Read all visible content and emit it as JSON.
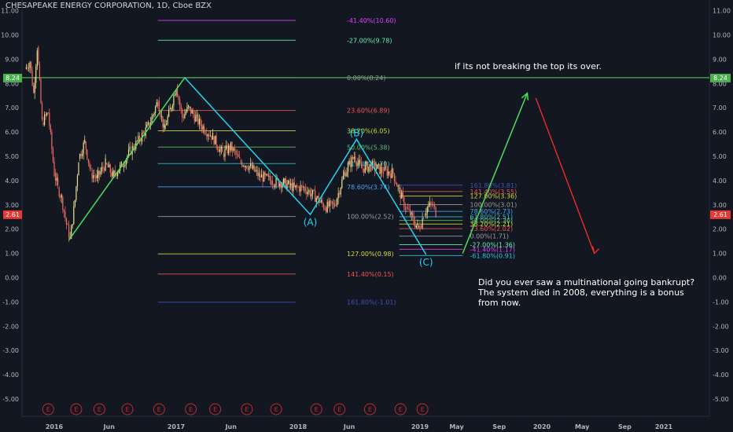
{
  "header": {
    "title": "CHESAPEAKE ENERGY CORPORATION, 1D, Cboe BZX"
  },
  "annotations": {
    "top_note": "if its not breaking the top its over.",
    "bottom_note": "Did you ever saw a multinational going bankrupt? The system died in 2008, everything is a bonus from now."
  },
  "colors": {
    "background": "#131722",
    "axis_text": "#b2b5be",
    "wave": "#22d3ee",
    "up_arrow": "#4ade5a",
    "down_arrow": "#ff2a2a",
    "candle_up": "#e9e08a",
    "candle_down": "#ef6b5f",
    "earnings": "#c62828"
  },
  "chart_data": {
    "type": "candlestick",
    "title": "CHESAPEAKE ENERGY CORPORATION, 1D, Cboe BZX",
    "y_axis": {
      "ylim": [
        -5.5,
        11.4
      ],
      "ticks": [
        11,
        10,
        9,
        8,
        7,
        6,
        5,
        4,
        3,
        2,
        1,
        0,
        -1,
        -2,
        -3,
        -4,
        -5
      ],
      "tick_labels": [
        "11.00",
        "10.00",
        "9.00",
        "8.00",
        "7.00",
        "6.00",
        "5.00",
        "4.00",
        "3.00",
        "2.00",
        "1.00",
        "0.00",
        "-1.00",
        "-2.00",
        "-3.00",
        "-4.00",
        "-5.00"
      ],
      "grid": false,
      "position": "both"
    },
    "x_axis": {
      "range": [
        2015.75,
        2021.25
      ],
      "ticks": [
        {
          "label": "2016",
          "x": 2016.0
        },
        {
          "label": "Jun",
          "x": 2016.45
        },
        {
          "label": "2017",
          "x": 2017.0
        },
        {
          "label": "Jun",
          "x": 2017.45
        },
        {
          "label": "2018",
          "x": 2018.0
        },
        {
          "label": "Jun",
          "x": 2018.42
        },
        {
          "label": "2019",
          "x": 2019.0
        },
        {
          "label": "May",
          "x": 2019.3
        },
        {
          "label": "Sep",
          "x": 2019.65
        },
        {
          "label": "2020",
          "x": 2020.0
        },
        {
          "label": "May",
          "x": 2020.33
        },
        {
          "label": "Sep",
          "x": 2020.68
        },
        {
          "label": "2021",
          "x": 2021.0
        }
      ]
    },
    "price_path": [
      [
        2015.76,
        8.6
      ],
      [
        2015.8,
        8.9
      ],
      [
        2015.83,
        7.6
      ],
      [
        2015.86,
        9.5
      ],
      [
        2015.9,
        6.4
      ],
      [
        2015.95,
        6.8
      ],
      [
        2016.0,
        4.3
      ],
      [
        2016.03,
        3.7
      ],
      [
        2016.06,
        3.3
      ],
      [
        2016.1,
        2.2
      ],
      [
        2016.13,
        1.6
      ],
      [
        2016.17,
        3.2
      ],
      [
        2016.2,
        4.9
      ],
      [
        2016.25,
        5.6
      ],
      [
        2016.3,
        4.3
      ],
      [
        2016.35,
        4.1
      ],
      [
        2016.42,
        4.7
      ],
      [
        2016.48,
        4.2
      ],
      [
        2016.55,
        4.6
      ],
      [
        2016.62,
        5.2
      ],
      [
        2016.7,
        5.7
      ],
      [
        2016.78,
        6.3
      ],
      [
        2016.85,
        7.3
      ],
      [
        2016.9,
        6.1
      ],
      [
        2016.95,
        6.9
      ],
      [
        2017.0,
        7.9
      ],
      [
        2017.05,
        6.6
      ],
      [
        2017.1,
        7.0
      ],
      [
        2017.2,
        6.3
      ],
      [
        2017.3,
        5.8
      ],
      [
        2017.38,
        5.1
      ],
      [
        2017.45,
        5.4
      ],
      [
        2017.52,
        4.8
      ],
      [
        2017.6,
        4.6
      ],
      [
        2017.68,
        4.2
      ],
      [
        2017.78,
        4.0
      ],
      [
        2017.88,
        3.9
      ],
      [
        2017.97,
        3.7
      ],
      [
        2018.05,
        3.7
      ],
      [
        2018.15,
        3.3
      ],
      [
        2018.22,
        2.9
      ],
      [
        2018.3,
        3.0
      ],
      [
        2018.38,
        4.3
      ],
      [
        2018.46,
        5.0
      ],
      [
        2018.52,
        4.5
      ],
      [
        2018.6,
        4.6
      ],
      [
        2018.7,
        4.4
      ],
      [
        2018.78,
        4.3
      ],
      [
        2018.82,
        3.7
      ],
      [
        2018.88,
        2.9
      ],
      [
        2018.92,
        2.6
      ],
      [
        2018.95,
        2.3
      ],
      [
        2018.98,
        2.1
      ],
      [
        2019.0,
        2.1
      ],
      [
        2019.03,
        2.6
      ],
      [
        2019.06,
        2.9
      ],
      [
        2019.1,
        3.0
      ],
      [
        2019.13,
        2.7
      ]
    ],
    "last_price": {
      "value": 2.61,
      "label": "2.61"
    },
    "resistance_line": {
      "value": 8.24,
      "label": "8.24"
    },
    "fib_retracement_1": {
      "levels": [
        {
          "pct": "-41.40%",
          "value": 10.6,
          "label": "-41.40%(10.60)",
          "color": "#e040fb"
        },
        {
          "pct": "-27.00%",
          "value": 9.78,
          "label": "-27.00%(9.78)",
          "color": "#69f0ae"
        },
        {
          "pct": "0.00%",
          "value": 8.24,
          "label": "0.00%(8.24)",
          "color": "#9e9e9e"
        },
        {
          "pct": "23.60%",
          "value": 6.89,
          "label": "23.60%(6.89)",
          "color": "#ef5350"
        },
        {
          "pct": "38.20%",
          "value": 6.05,
          "label": "38.20%(6.05)",
          "color": "#cddc39"
        },
        {
          "pct": "50.00%",
          "value": 5.38,
          "label": "50.00%(5.38)",
          "color": "#66bb6a"
        },
        {
          "pct": "61.80%",
          "value": 4.7,
          "label": "61.80%(4.70)",
          "color": "#26c6da"
        },
        {
          "pct": "78.60%",
          "value": 3.74,
          "label": "78.60%(3.74)",
          "color": "#42a5f5"
        },
        {
          "pct": "100.00%",
          "value": 2.52,
          "label": "100.00%(2.52)",
          "color": "#9e9e9e"
        },
        {
          "pct": "127.00%",
          "value": 0.98,
          "label": "127.00%(0.98)",
          "color": "#cddc39"
        },
        {
          "pct": "141.40%",
          "value": 0.15,
          "label": "141.40%(0.15)",
          "color": "#ef5350"
        },
        {
          "pct": "161.80%",
          "value": -1.01,
          "label": "161.80%(-1.01)",
          "color": "#3f51b5"
        }
      ]
    },
    "fib_retracement_2": {
      "levels": [
        {
          "pct": "161.80%",
          "value": 3.81,
          "label": "161.80%(3.81)",
          "color": "#3f51b5"
        },
        {
          "pct": "141.40%",
          "value": 3.55,
          "label": "141.40%(3.55)",
          "color": "#ef5350"
        },
        {
          "pct": "127.00%",
          "value": 3.36,
          "label": "127.00%(3.36)",
          "color": "#cddc39"
        },
        {
          "pct": "100.00%",
          "value": 3.01,
          "label": "100.00%(3.01)",
          "color": "#9e9e9e"
        },
        {
          "pct": "78.60%",
          "value": 2.73,
          "label": "78.60%(2.73)",
          "color": "#42a5f5"
        },
        {
          "pct": "61.80%",
          "value": 2.51,
          "label": "61.80%(2.51)",
          "color": "#26c6da"
        },
        {
          "pct": "50.00%",
          "value": 2.36,
          "label": "50.00%(2.36)",
          "color": "#66bb6a"
        },
        {
          "pct": "38.20%",
          "value": 2.21,
          "label": "38.20%(2.21)",
          "color": "#cddc39"
        },
        {
          "pct": "23.60%",
          "value": 2.02,
          "label": "23.60%(2.02)",
          "color": "#ef5350"
        },
        {
          "pct": "0.00%",
          "value": 1.71,
          "label": "0.00%(1.71)",
          "color": "#9e9e9e"
        },
        {
          "pct": "-27.00%",
          "value": 1.36,
          "label": "-27.00%(1.36)",
          "color": "#69f0ae"
        },
        {
          "pct": "-41.40%",
          "value": 1.17,
          "label": "-41.40%(1.17)",
          "color": "#e040fb"
        },
        {
          "pct": "-61.80%",
          "value": 0.91,
          "label": "-61.80%(0.91)",
          "color": "#26c6da"
        }
      ]
    },
    "wave_abc": [
      [
        2017.07,
        8.24
      ],
      [
        2018.1,
        2.6
      ],
      [
        2018.48,
        5.7
      ],
      [
        2019.05,
        0.95
      ]
    ],
    "wave_labels": [
      {
        "label": "(B)",
        "x": 2018.48,
        "y": 5.7
      },
      {
        "label": "(A)",
        "x": 2018.1,
        "y": 2.6
      },
      {
        "label": "(C)",
        "x": 2019.05,
        "y": 0.95
      }
    ],
    "impulse_line": [
      [
        2016.12,
        1.55
      ],
      [
        2017.07,
        8.24
      ]
    ],
    "projection_up": [
      [
        2019.35,
        1.0
      ],
      [
        2019.88,
        7.6
      ]
    ],
    "projection_down": [
      [
        2019.95,
        7.4
      ],
      [
        2020.43,
        1.0
      ]
    ],
    "earnings_markers": {
      "label": "E",
      "x": [
        2015.95,
        2016.18,
        2016.37,
        2016.6,
        2016.86,
        2017.12,
        2017.32,
        2017.58,
        2017.82,
        2018.15,
        2018.34,
        2018.59,
        2018.84,
        2019.02
      ]
    }
  }
}
